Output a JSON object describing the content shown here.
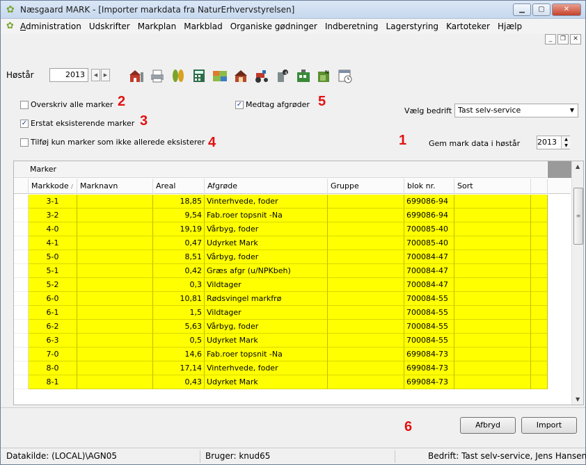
{
  "window": {
    "title": "Næsgaard MARK - [Importer markdata fra NaturErhvervstyrelsen]"
  },
  "menu": [
    "Administration",
    "Udskrifter",
    "Markplan",
    "Markblad",
    "Organiske gødninger",
    "Indberetning",
    "Lagerstyring",
    "Kartoteker",
    "Hjælp"
  ],
  "toolbar": {
    "harvest_label": "Høstår",
    "harvest_year": "2013"
  },
  "options": {
    "overwrite_all": {
      "label": "Overskriv alle marker",
      "checked": false,
      "marker": "2"
    },
    "replace_existing": {
      "label": "Erstat eksisterende marker",
      "checked": true,
      "marker": "3"
    },
    "add_only_new": {
      "label": "Tilføj kun marker som ikke allerede eksisterer",
      "checked": false,
      "marker": "4"
    },
    "include_crops": {
      "label": "Medtag afgrøder",
      "checked": true,
      "marker": "5"
    },
    "company_label": "Vælg bedrift",
    "company_value": "Tast selv-service",
    "save_label": "Gem mark data i høstår",
    "save_year": "2013",
    "save_marker": "1"
  },
  "grid": {
    "group_label": "Marker",
    "columns": [
      "Markkode",
      "Marknavn",
      "Areal",
      "Afgrøde",
      "Gruppe",
      "blok nr.",
      "Sort"
    ],
    "rows": [
      {
        "markkode": "3-1",
        "marknavn": "",
        "areal": "18,85",
        "afgrode": "Vinterhvede, foder",
        "gruppe": "",
        "blok": "699086-94",
        "sort": ""
      },
      {
        "markkode": "3-2",
        "marknavn": "",
        "areal": "9,54",
        "afgrode": "Fab.roer topsnit -Na",
        "gruppe": "",
        "blok": "699086-94",
        "sort": ""
      },
      {
        "markkode": "4-0",
        "marknavn": "",
        "areal": "19,19",
        "afgrode": "Vårbyg, foder",
        "gruppe": "",
        "blok": "700085-40",
        "sort": ""
      },
      {
        "markkode": "4-1",
        "marknavn": "",
        "areal": "0,47",
        "afgrode": "Udyrket Mark",
        "gruppe": "",
        "blok": "700085-40",
        "sort": ""
      },
      {
        "markkode": "5-0",
        "marknavn": "",
        "areal": "8,51",
        "afgrode": "Vårbyg, foder",
        "gruppe": "",
        "blok": "700084-47",
        "sort": ""
      },
      {
        "markkode": "5-1",
        "marknavn": "",
        "areal": "0,42",
        "afgrode": "Græs afgr (u/NPKbeh)",
        "gruppe": "",
        "blok": "700084-47",
        "sort": ""
      },
      {
        "markkode": "5-2",
        "marknavn": "",
        "areal": "0,3",
        "afgrode": "Vildtager",
        "gruppe": "",
        "blok": "700084-47",
        "sort": ""
      },
      {
        "markkode": "6-0",
        "marknavn": "",
        "areal": "10,81",
        "afgrode": "Rødsvingel markfrø",
        "gruppe": "",
        "blok": "700084-55",
        "sort": ""
      },
      {
        "markkode": "6-1",
        "marknavn": "",
        "areal": "1,5",
        "afgrode": "Vildtager",
        "gruppe": "",
        "blok": "700084-55",
        "sort": ""
      },
      {
        "markkode": "6-2",
        "marknavn": "",
        "areal": "5,63",
        "afgrode": "Vårbyg, foder",
        "gruppe": "",
        "blok": "700084-55",
        "sort": ""
      },
      {
        "markkode": "6-3",
        "marknavn": "",
        "areal": "0,5",
        "afgrode": "Udyrket Mark",
        "gruppe": "",
        "blok": "700084-55",
        "sort": ""
      },
      {
        "markkode": "7-0",
        "marknavn": "",
        "areal": "14,6",
        "afgrode": "Fab.roer topsnit -Na",
        "gruppe": "",
        "blok": "699084-73",
        "sort": ""
      },
      {
        "markkode": "8-0",
        "marknavn": "",
        "areal": "17,14",
        "afgrode": "Vinterhvede, foder",
        "gruppe": "",
        "blok": "699084-73",
        "sort": ""
      },
      {
        "markkode": "8-1",
        "marknavn": "",
        "areal": "0,43",
        "afgrode": "Udyrket Mark",
        "gruppe": "",
        "blok": "699084-73",
        "sort": ""
      }
    ]
  },
  "buttons": {
    "cancel": "Afbryd",
    "import": "Import",
    "marker": "6"
  },
  "status": {
    "datasource": "Datakilde: (LOCAL)\\AGN05",
    "user": "Bruger: knud65",
    "company": "Bedrift: Tast selv-service, Jens Hansen"
  },
  "colors": {
    "row_highlight": "#ffff00",
    "marker_red": "#e41010"
  }
}
